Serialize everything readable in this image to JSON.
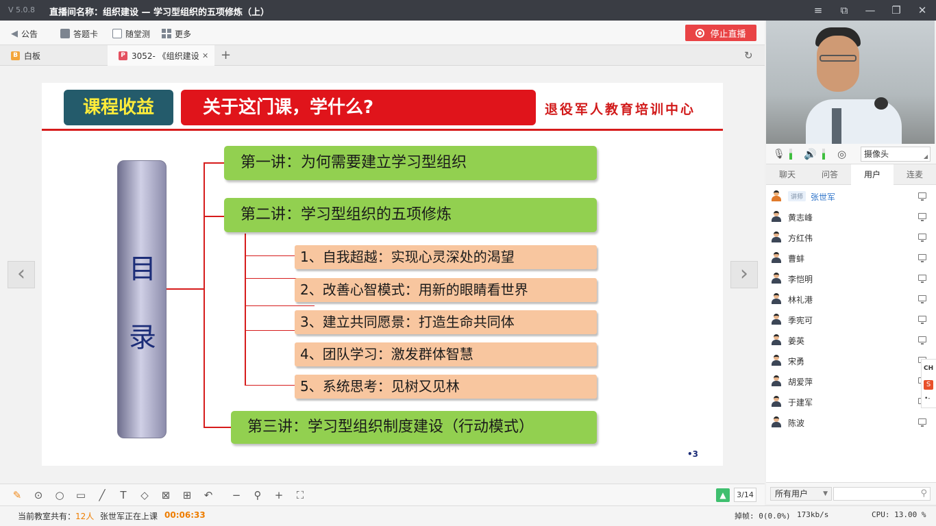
{
  "window": {
    "version": "V 5.0.8",
    "title": "直播间名称：组织建设 — 学习型组织的五项修炼（上）"
  },
  "toolbar": {
    "announce": "公告",
    "answer_card": "答题卡",
    "quiz": "随堂测",
    "more": "更多",
    "stop_live": "停止直播"
  },
  "tabs": {
    "whiteboard": {
      "badge": "B",
      "label": "白板"
    },
    "ppt": {
      "badge": "P",
      "label": "3052- 《组织建设"
    },
    "add": "+"
  },
  "slide": {
    "header_left": "课程收益",
    "header_main": "关于这门课，学什么?",
    "header_org": "退役军人教育培训中心",
    "pillar_top": "目",
    "pillar_bottom": "录",
    "lecture1": "第一讲：为何需要建立学习型组织",
    "lecture2": "第二讲：学习型组织的五项修炼",
    "items": [
      "1、自我超越：实现心灵深处的渴望",
      "2、改善心智模式：用新的眼睛看世界",
      "3、建立共同愿景：打造生命共同体",
      "4、团队学习：激发群体智慧",
      "5、系统思考：见树又见林"
    ],
    "lecture3": "第三讲：学习型组织制度建设（行动模式）",
    "page_mark": "•3"
  },
  "drawbar": {
    "page_indicator": "3/14"
  },
  "status": {
    "online_prefix": "当前教室共有：",
    "online_count": "12人",
    "teacher_status": "张世军正在上课",
    "elapsed": "00:06:33",
    "dropped_frames": "掉帧: 0(0.0%)",
    "bitrate": "173kb/s",
    "cpu": "CPU: 13.00 %"
  },
  "av": {
    "camera_label": "摄像头"
  },
  "right_tabs": [
    "聊天",
    "问答",
    "用户",
    "连麦"
  ],
  "users": {
    "teacher_tag": "讲师",
    "list": [
      "张世军",
      "黄志峰",
      "方红伟",
      "曹蚌",
      "李恺明",
      "林礼港",
      "季宪可",
      "姜英",
      "宋勇",
      "胡爱萍",
      "于建军",
      "陈波"
    ]
  },
  "user_filter": {
    "selected": "所有用户"
  },
  "side_widget": {
    "ch": "CH",
    "s": "S"
  },
  "colors": {
    "stop_red": "#e94345",
    "slide_red": "#e0141b",
    "slide_teal": "#245b6b",
    "lecture_green": "#92d050",
    "item_orange": "#f8c69f",
    "elapsed_orange": "#ee7d00",
    "teacher_blue": "#2d73c9"
  }
}
